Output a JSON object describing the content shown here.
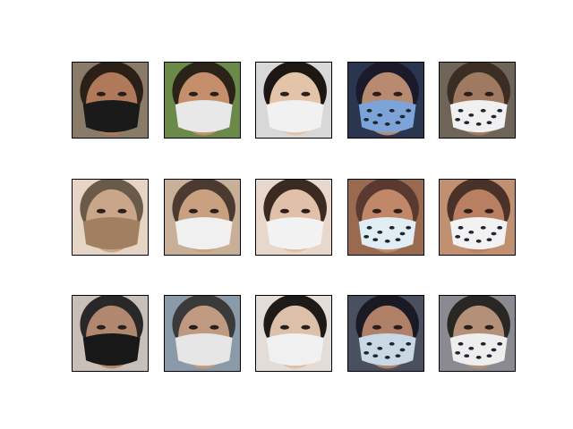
{
  "figure": {
    "background": "#ffffff",
    "grid": {
      "rows": 3,
      "cols": 5
    },
    "row_labels": [],
    "col_labels": [],
    "tiles": [
      {
        "subject": "man-black-n95-mask",
        "skin": "#b07a5a",
        "hair": "#2a2018",
        "mask": "#1a1a1a",
        "bg": "#8a7a68"
      },
      {
        "subject": "boy-white-mask-outdoor",
        "skin": "#c48f6a",
        "hair": "#2b2218",
        "mask": "#e8e8e8",
        "bg": "#6b8a4a"
      },
      {
        "subject": "woman-glasses-white-mask",
        "skin": "#e4c4a8",
        "hair": "#1c1714",
        "mask": "#f1f1f1",
        "bg": "#d8d8d8"
      },
      {
        "subject": "woman-leopard-print-mask",
        "skin": "#b88a70",
        "hair": "#1a1a2a",
        "mask": "#7da4d8",
        "bg": "#2a3550"
      },
      {
        "subject": "woman-spotted-mask",
        "skin": "#a07a60",
        "hair": "#3a2e24",
        "mask": "#f0f0f0",
        "bg": "#6f6458"
      },
      {
        "subject": "man-tan-mask-reconstructed",
        "skin": "#c9a58a",
        "hair": "#6a5a4a",
        "mask": "#a08060",
        "bg": "#e6d4c4"
      },
      {
        "subject": "boy-white-mask-reconstructed",
        "skin": "#c9a080",
        "hair": "#4a3a30",
        "mask": "#f0f0f0",
        "bg": "#c8b098"
      },
      {
        "subject": "woman-long-hair-white-mask-reconstructed",
        "skin": "#e0c0a8",
        "hair": "#3a2a22",
        "mask": "#f2f2f2",
        "bg": "#e8d8cc"
      },
      {
        "subject": "woman-leopard-mask-reconstructed",
        "skin": "#c08868",
        "hair": "#5a3a30",
        "mask": "#e0eef4",
        "bg": "#9a6a50"
      },
      {
        "subject": "woman-spotted-mask-reconstructed",
        "skin": "#b88060",
        "hair": "#4a3228",
        "mask": "#f2f2f2",
        "bg": "#c09070"
      },
      {
        "subject": "man-black-mask-output",
        "skin": "#b08870",
        "hair": "#282828",
        "mask": "#181818",
        "bg": "#c8c0b8"
      },
      {
        "subject": "boy-white-mask-output",
        "skin": "#c09a80",
        "hair": "#3a3a3a",
        "mask": "#e6e6e6",
        "bg": "#8a9aa8"
      },
      {
        "subject": "woman-glasses-mask-output",
        "skin": "#dcc0aa",
        "hair": "#1e1a18",
        "mask": "#f0f0f0",
        "bg": "#e4dcd6"
      },
      {
        "subject": "woman-leopard-mask-output",
        "skin": "#b08068",
        "hair": "#1a1a24",
        "mask": "#c8d8e4",
        "bg": "#4a5060"
      },
      {
        "subject": "woman-spotted-mask-output",
        "skin": "#b49078",
        "hair": "#2a2624",
        "mask": "#eeeeee",
        "bg": "#8a8a90"
      }
    ]
  }
}
